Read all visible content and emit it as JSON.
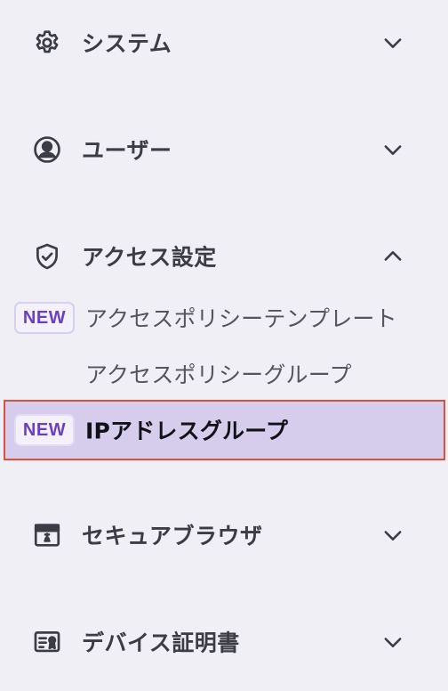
{
  "nav": {
    "system": {
      "label": "システム",
      "icon": "gear-icon",
      "chevron": "chevron-down-icon"
    },
    "users": {
      "label": "ユーザー",
      "icon": "user-circle-icon",
      "chevron": "chevron-down-icon"
    },
    "access": {
      "label": "アクセス設定",
      "icon": "shield-check-icon",
      "chevron": "chevron-up-icon",
      "items": [
        {
          "label": "アクセスポリシーテンプレート",
          "badge": "NEW"
        },
        {
          "label": "アクセスポリシーグループ"
        },
        {
          "label": "IPアドレスグループ",
          "badge": "NEW",
          "active": true
        }
      ]
    },
    "browser": {
      "label": "セキュアブラウザ",
      "icon": "browser-window-icon",
      "chevron": "chevron-down-icon"
    },
    "device": {
      "label": "デバイス証明書",
      "icon": "certificate-icon",
      "chevron": "chevron-down-icon"
    }
  },
  "colors": {
    "background": "#f0eff5",
    "active_bg": "#d6cdec",
    "active_border": "#d8533d",
    "badge_text": "#6a3fc0"
  }
}
